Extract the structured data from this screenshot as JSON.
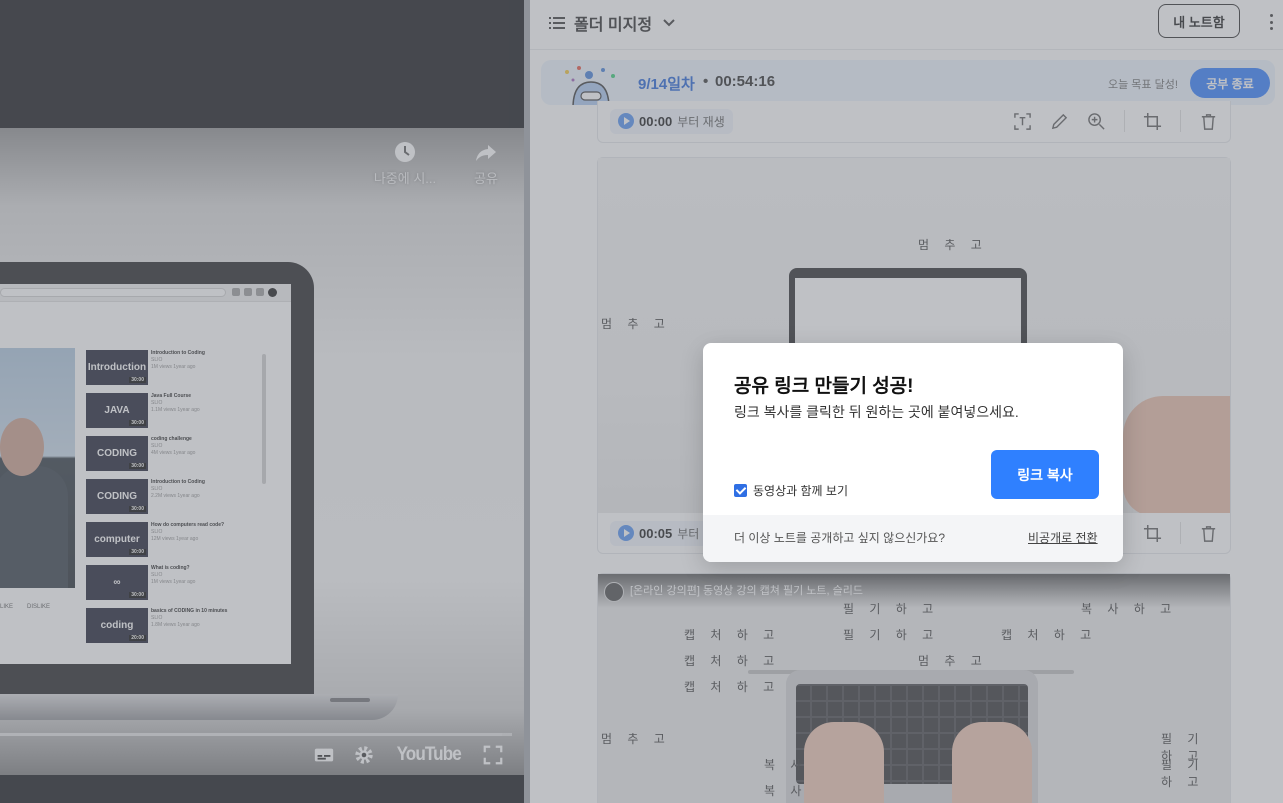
{
  "video": {
    "watch_later_label": "나중에 시...",
    "share_label": "공유",
    "brand_label": "YouTube",
    "progress_fraction": 0.98,
    "embedded_playlist": [
      {
        "thumb": "Introduction",
        "title": "Introduction to Coding",
        "channel": "SLIO",
        "meta": "1M views 1year ago",
        "duration": "30:00"
      },
      {
        "thumb": "JAVA",
        "title": "Java Full Course",
        "channel": "SLIO",
        "meta": "1.1M views 1year ago",
        "duration": "30:00"
      },
      {
        "thumb": "CODING",
        "title": "coding challenge",
        "channel": "SLIO",
        "meta": "4M views 1year ago",
        "duration": "30:00"
      },
      {
        "thumb": "CODING",
        "title": "Introduction to Coding",
        "channel": "SLIO",
        "meta": "2.2M views 1year ago",
        "duration": "30:00"
      },
      {
        "thumb": "computer",
        "title": "How do computers read code?",
        "channel": "SLIO",
        "meta": "12M views 1year ago",
        "duration": "30:00"
      },
      {
        "thumb": "∞",
        "title": "What is coding?",
        "channel": "SLIO",
        "meta": "1M views 1year ago",
        "duration": "30:00"
      },
      {
        "thumb": "coding",
        "title": "basics of CODING in 10 minutes",
        "channel": "SLIO",
        "meta": "1.8M views 1year ago",
        "duration": "20:00"
      }
    ],
    "like_label": "LIKE",
    "dislike_label": "DISLIKE"
  },
  "notes": {
    "folder_label": "폴더 미지정",
    "notebox_label": "내 노트함",
    "study": {
      "day": "9/14일차",
      "separator": "•",
      "timer": "00:54:16",
      "goal": "오늘 목표 달성!",
      "end_label": "공부 종료"
    },
    "card1": {
      "time": "00:00",
      "suffix": "부터 재생",
      "words": [
        "멈 추 고",
        "멈 추 고"
      ]
    },
    "card2": {
      "time": "00:05",
      "suffix": "부터 재생"
    },
    "card3": {
      "title": "[온라인 강의편] 동영상 강의 캡쳐 필기 노트, 슬리드",
      "words": [
        "필 기 하 고",
        "복 사 하 고",
        "캡 처 하 고",
        "필 기 하 고",
        "캡 처 하 고",
        "캡 처 하 고",
        "멈 추 고",
        "캡 처 하 고",
        "멈 추 고",
        "필 기 하 고",
        "필 기 하 고",
        "복 사",
        "복 사"
      ]
    }
  },
  "dialog": {
    "title": "공유 링크 만들기 성공!",
    "description": "링크 복사를 클릭한 뒤 원하는 곳에 붙여넣으세요.",
    "checkbox_label": "동영상과 함께 보기",
    "checkbox_checked": true,
    "copy_label": "링크 복사",
    "footer_question": "더 이상 노트를 공개하고 싶지 않으신가요?",
    "footer_link": "비공개로 전환"
  },
  "colors": {
    "accent": "#2f80ff",
    "study_bar_bg": "#eaf3fd",
    "day_text": "#1d5fd6",
    "video_bg": "#0b0c10"
  }
}
